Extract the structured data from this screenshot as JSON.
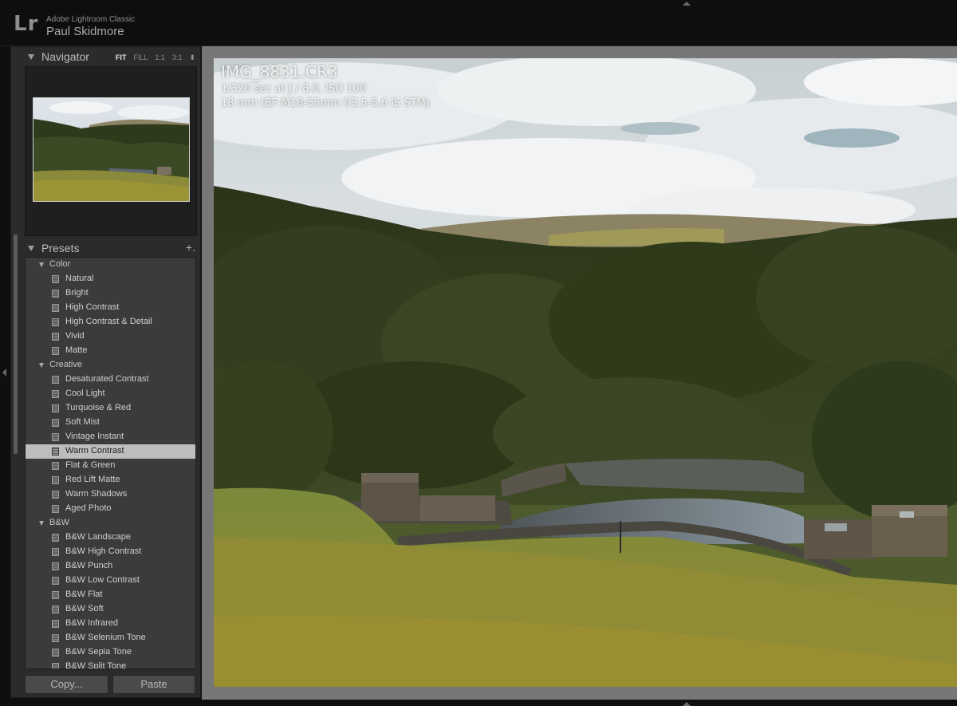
{
  "app": {
    "logo": "Lr",
    "product_name": "Adobe Lightroom Classic",
    "user_name": "Paul Skidmore"
  },
  "navigator": {
    "title": "Navigator",
    "zoom_options": [
      "FIT",
      "FILL",
      "1:1",
      "3:1"
    ],
    "active_zoom": "FIT",
    "zoom_stepper": "⬍"
  },
  "presets": {
    "title": "Presets",
    "add_label": "+.",
    "folders": [
      {
        "name": "Color",
        "items": [
          "Natural",
          "Bright",
          "High Contrast",
          "High Contrast & Detail",
          "Vivid",
          "Matte"
        ]
      },
      {
        "name": "Creative",
        "items": [
          "Desaturated Contrast",
          "Cool Light",
          "Turquoise & Red",
          "Soft Mist",
          "Vintage Instant",
          "Warm Contrast",
          "Flat & Green",
          "Red Lift Matte",
          "Warm Shadows",
          "Aged Photo"
        ]
      },
      {
        "name": "B&W",
        "items": [
          "B&W Landscape",
          "B&W High Contrast",
          "B&W Punch",
          "B&W Low Contrast",
          "B&W Flat",
          "B&W Soft",
          "B&W Infrared",
          "B&W Selenium Tone",
          "B&W Sepia Tone",
          "B&W Split Tone"
        ]
      }
    ],
    "selected": "Warm Contrast"
  },
  "buttons": {
    "copy": "Copy...",
    "paste": "Paste"
  },
  "photo_info": {
    "filename": "IMG_8831.CR3",
    "exposure": "1/320 sec at ƒ / 8.0, ISO 100",
    "lens": "18 mm (EF-M18-55mm f/3.5-5.6 IS STM)"
  },
  "icons": {
    "panel_toggle": "triangle-down-icon",
    "preset": "preset-icon",
    "top_panel_collapse": "triangle-up-icon",
    "left_panel_collapse": "triangle-left-icon"
  },
  "colors": {
    "selected_row": "#bdbdbd",
    "panel_bg": "#2b2b2b",
    "list_bg": "#3b3b3b",
    "viewer_bg": "#777777"
  }
}
